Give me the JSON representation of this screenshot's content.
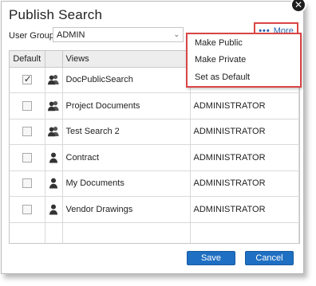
{
  "dialog": {
    "title": "Publish Search",
    "close_icon": "close-icon"
  },
  "user_group": {
    "label": "User Group:",
    "value": "ADMIN"
  },
  "more": {
    "label": "More",
    "icon": "ellipsis-icon"
  },
  "grid": {
    "columns": [
      "Default",
      "",
      "Views",
      ""
    ],
    "rows": [
      {
        "default": true,
        "icon": "group-icon",
        "view": "DocPublicSearch",
        "owner": ""
      },
      {
        "default": false,
        "icon": "group-icon",
        "view": "Project Documents",
        "owner": "ADMINISTRATOR"
      },
      {
        "default": false,
        "icon": "group-icon",
        "view": "Test Search 2",
        "owner": "ADMINISTRATOR"
      },
      {
        "default": false,
        "icon": "person-icon",
        "view": "Contract",
        "owner": "ADMINISTRATOR"
      },
      {
        "default": false,
        "icon": "person-icon",
        "view": "My Documents",
        "owner": "ADMINISTRATOR"
      },
      {
        "default": false,
        "icon": "person-icon",
        "view": "Vendor Drawings",
        "owner": "ADMINISTRATOR"
      }
    ]
  },
  "menu": {
    "items": [
      "Make Public",
      "Make Private",
      "Set as Default"
    ]
  },
  "footer": {
    "save_label": "Save",
    "cancel_label": "Cancel"
  },
  "colors": {
    "accent": "#1f6fc2",
    "highlight": "#d94545",
    "link": "#2a63ad"
  }
}
